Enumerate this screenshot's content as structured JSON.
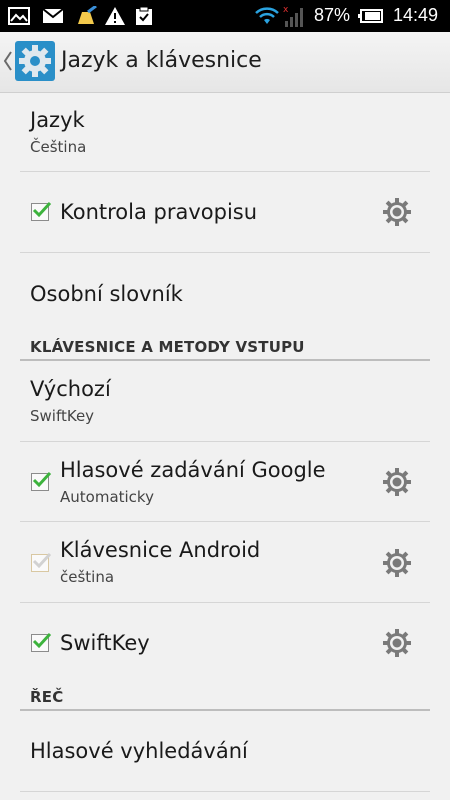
{
  "status_bar": {
    "battery_percent": "87%",
    "time": "14:49",
    "icons": [
      "gallery-icon",
      "gmail-icon",
      "clean-icon",
      "warning-icon",
      "clipboard-check-icon",
      "wifi-icon",
      "signal-icon",
      "battery-icon"
    ]
  },
  "action_bar": {
    "title": "Jazyk a klávesnice",
    "icon": "settings-gear-icon",
    "back_icon": "chevron-left-icon"
  },
  "settings": {
    "language": {
      "title": "Jazyk",
      "summary": "Čeština"
    },
    "spell_check": {
      "title": "Kontrola pravopisu",
      "checked": true
    },
    "personal_dictionary": {
      "title": "Osobní slovník"
    },
    "section_keyboards": "KLÁVESNICE A METODY VSTUPU",
    "default": {
      "title": "Výchozí",
      "summary": "SwiftKey"
    },
    "google_voice": {
      "title": "Hlasové zadávání Google",
      "summary": "Automaticky",
      "checked": true
    },
    "android_keyboard": {
      "title": "Klávesnice Android",
      "summary": "čeština",
      "checked": true,
      "disabled": true
    },
    "swiftkey": {
      "title": "SwiftKey",
      "checked": true
    },
    "section_speech": "ŘEČ",
    "voice_search": {
      "title": "Hlasové vyhledávání"
    }
  },
  "colors": {
    "check_green": "#3db33d",
    "gear_gray": "#7a7a7a",
    "app_icon_blue": "#2a8fc8",
    "background": "#f1f1f1"
  }
}
